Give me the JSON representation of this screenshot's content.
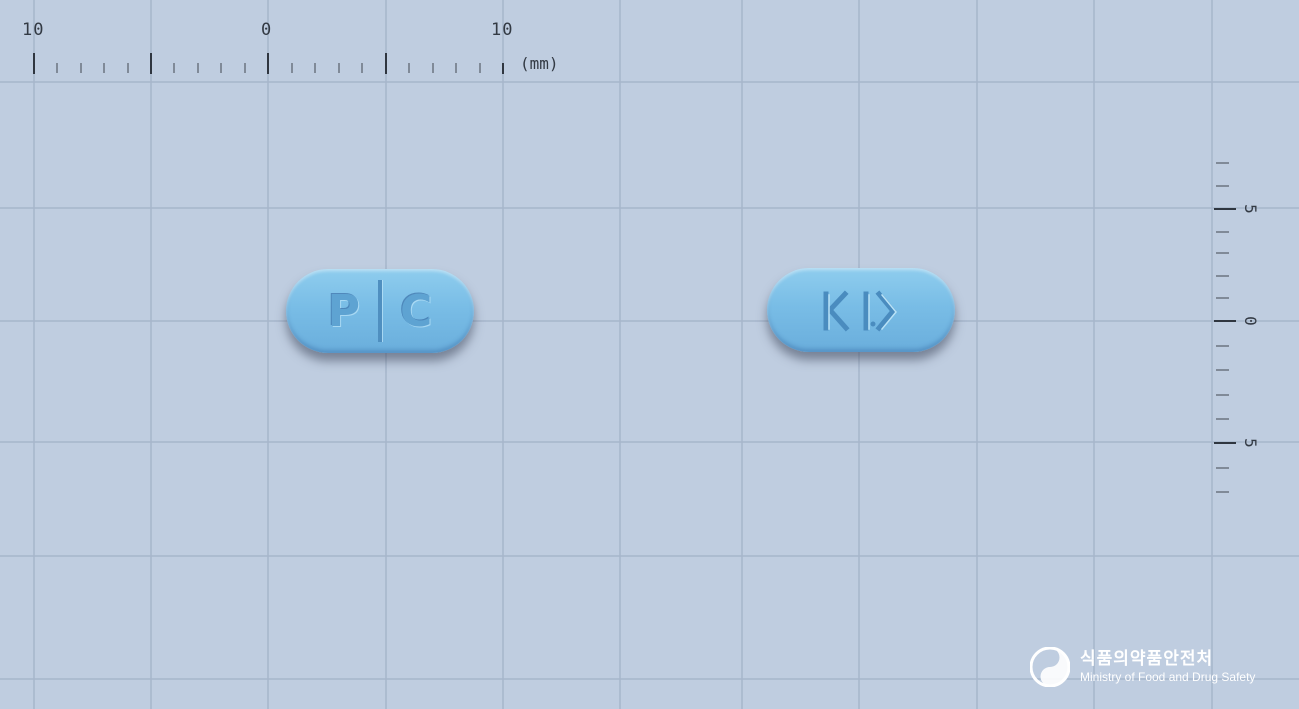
{
  "ruler_top": {
    "labels": [
      "10",
      "0",
      "10"
    ],
    "unit": "(mm)"
  },
  "ruler_right": {
    "labels": [
      "5",
      "0",
      "5"
    ]
  },
  "pills": [
    {
      "imprint_left": "P",
      "imprint_right": "C",
      "has_score_line": true,
      "color": "#7cc0e8"
    },
    {
      "imprint": "KI>",
      "color": "#7cc0e8"
    }
  ],
  "watermark": {
    "korean": "식품의약품안전처",
    "english": "Ministry of Food and Drug Safety"
  },
  "colors": {
    "background": "#bfcde0",
    "grid": "#a3b3c8",
    "pill": "#7cc0e8"
  }
}
